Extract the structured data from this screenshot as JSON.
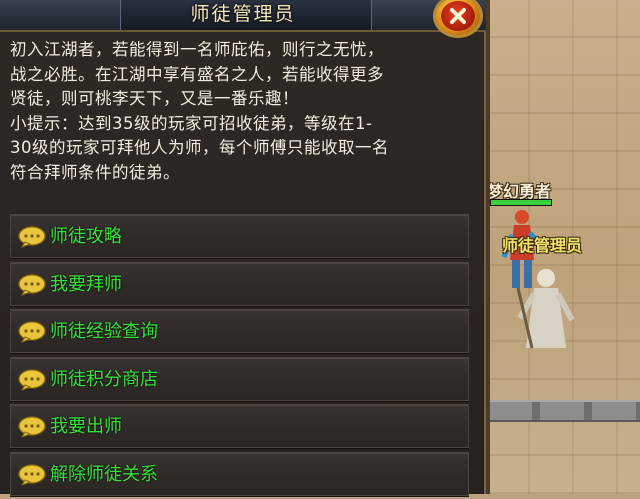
{
  "dialog": {
    "title": "师徒管理员",
    "intro": [
      "初入江湖者，若能得到一名师庇佑，则行之无忧，",
      "战之必胜。在江湖中享有盛名之人，若能收得更多",
      "贤徒，则可桃李天下，又是一番乐趣！",
      "小提示：达到35级的玩家可招收徒弟，等级在1-",
      "30级的玩家可拜他人为师，每个师傅只能收取一名",
      "符合拜师条件的徒弟。"
    ],
    "options": [
      {
        "label": "师徒攻略"
      },
      {
        "label": "我要拜师"
      },
      {
        "label": "师徒经验查询"
      },
      {
        "label": "师徒积分商店"
      },
      {
        "label": "我要出师"
      },
      {
        "label": "解除师徒关系"
      }
    ],
    "close_icon": "close-x-icon",
    "option_icon": "chat-bubble-icon"
  },
  "world": {
    "player_name": "梦幻勇者",
    "player_hp_fraction": 1.0,
    "npc_name": "师徒管理员"
  },
  "colors": {
    "option_text": "#35e03a",
    "npc_name": "#f2e36a",
    "title_text": "#f6e7b8",
    "close_button": "#e08a16"
  }
}
